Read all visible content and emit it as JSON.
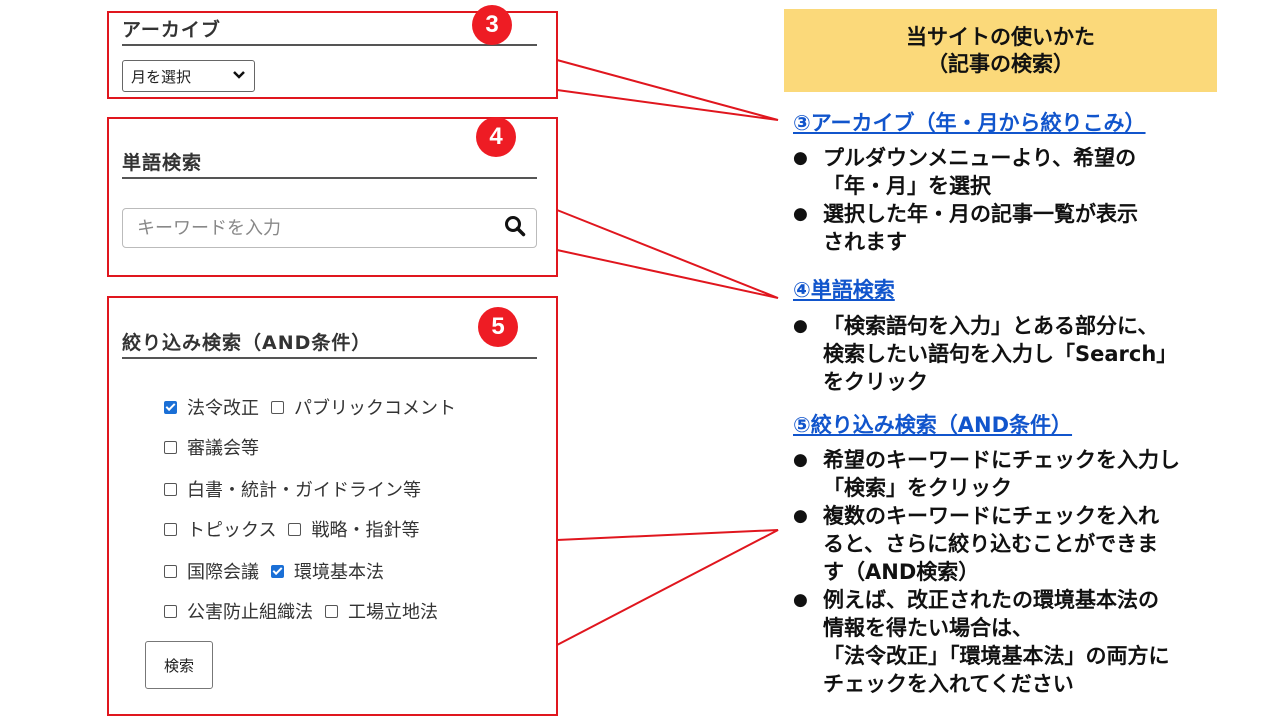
{
  "archive": {
    "title": "アーカイブ",
    "badge": "3",
    "select_value": "月を選択",
    "chevron": "chevron-down-icon"
  },
  "word_search": {
    "title": "単語検索",
    "badge": "4",
    "placeholder": "キーワードを入力",
    "icon": "search-icon"
  },
  "filter": {
    "title": "絞り込み検索（AND条件）",
    "badge": "5",
    "rows": [
      [
        {
          "label": "法令改正",
          "checked": true
        },
        {
          "label": "パブリックコメント",
          "checked": false
        }
      ],
      [
        {
          "label": "審議会等",
          "checked": false
        }
      ],
      [
        {
          "label": "白書・統計・ガイドライン等",
          "checked": false
        }
      ],
      [
        {
          "label": "トピックス",
          "checked": false
        },
        {
          "label": "戦略・指針等",
          "checked": false
        }
      ],
      [
        {
          "label": "国際会議",
          "checked": false
        },
        {
          "label": "環境基本法",
          "checked": true
        }
      ],
      [
        {
          "label": "公害防止組織法",
          "checked": false
        },
        {
          "label": "工場立地法",
          "checked": false
        }
      ]
    ],
    "submit_label": "検索"
  },
  "guide": {
    "heading_line1": "当サイトの使いかた",
    "heading_line2": "（記事の検索）",
    "sections": [
      {
        "link": "③アーカイブ（年・月から絞りこみ）",
        "bullets": [
          "プルダウンメニューより、希望の\n「年・月」を選択",
          "選択した年・月の記事一覧が表示\nされます"
        ]
      },
      {
        "link": "④単語検索",
        "bullets": [
          "「検索語句を入力」とある部分に、\n検索したい語句を入力し「Search」\nをクリック"
        ]
      },
      {
        "link": "⑤絞り込み検索（AND条件）",
        "bullets": [
          "希望のキーワードにチェックを入力し\n「検索」をクリック",
          "複数のキーワードにチェックを入れ\nると、さらに絞り込むことができま\nす（AND検索）",
          "例えば、改正されたの環境基本法の\n情報を得たい場合は、\n「法令改正」「環境基本法」の両方に\nチェックを入れてください"
        ]
      }
    ]
  },
  "colors": {
    "frame": "#e0161e",
    "badge": "#ee1c24",
    "guide_bg": "#fbd97a",
    "link": "#1155cc",
    "checkbox_on": "#1a6fd6"
  }
}
